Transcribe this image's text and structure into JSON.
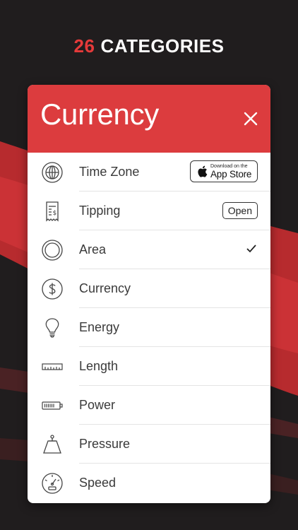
{
  "promo": {
    "count": "26",
    "headline": "CATEGORIES"
  },
  "card": {
    "title": "Currency",
    "close_icon": "close-icon"
  },
  "rows": [
    {
      "label": "Time Zone",
      "icon": "globe-icon",
      "badge": {
        "type": "appstore",
        "small": "Download on the",
        "big": "App Store"
      }
    },
    {
      "label": "Tipping",
      "icon": "receipt-icon",
      "badge": {
        "type": "open",
        "text": "Open"
      }
    },
    {
      "label": "Area",
      "icon": "area-circle-icon",
      "selected": true
    },
    {
      "label": "Currency",
      "icon": "dollar-coin-icon"
    },
    {
      "label": "Energy",
      "icon": "lightbulb-icon"
    },
    {
      "label": "Length",
      "icon": "ruler-icon"
    },
    {
      "label": "Power",
      "icon": "battery-icon"
    },
    {
      "label": "Pressure",
      "icon": "weight-icon"
    },
    {
      "label": "Speed",
      "icon": "speedometer-icon"
    }
  ],
  "colors": {
    "accent": "#dc3c3e",
    "background": "#201d1e",
    "count": "#e53a3a"
  }
}
